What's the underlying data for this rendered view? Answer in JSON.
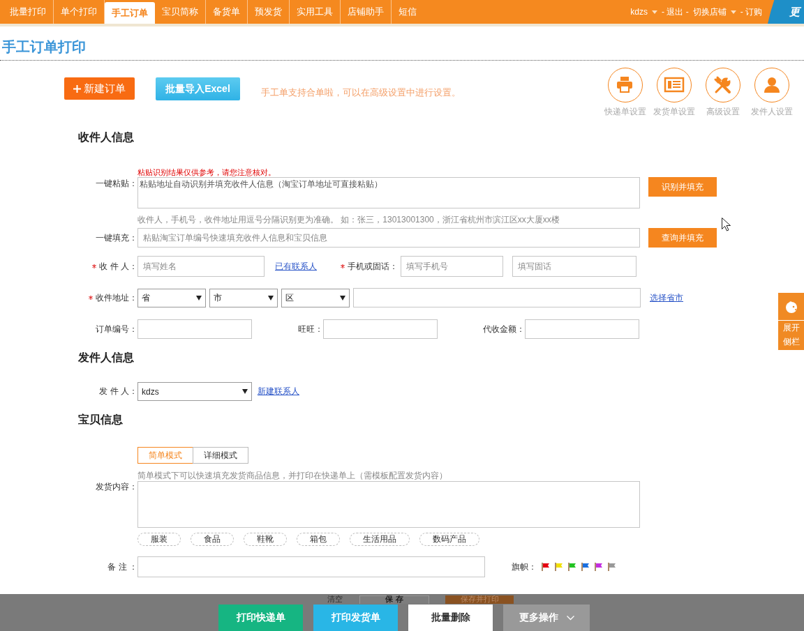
{
  "nav": {
    "items": [
      {
        "label": "批量打印",
        "selected": false
      },
      {
        "label": "单个打印",
        "selected": false
      },
      {
        "label": "手工订单",
        "selected": true
      },
      {
        "label": "宝贝简称",
        "selected": false
      },
      {
        "label": "备货单",
        "selected": false
      },
      {
        "label": "预发货",
        "selected": false
      },
      {
        "label": "实用工具",
        "selected": false
      },
      {
        "label": "店铺助手",
        "selected": false
      },
      {
        "label": "短信",
        "selected": false
      }
    ],
    "user": "kdzs",
    "logout": "- 退出 -",
    "switch_shop": "切换店铺",
    "subscribe": "- 订购",
    "logo": "更"
  },
  "page_title": "手工订单打印",
  "toolbar": {
    "new_order": "新建订单",
    "import_excel": "批量导入Excel",
    "note": "手工单支持合单啦，可以在高级设置中进行设置。",
    "settings": [
      {
        "kind": "printer",
        "label": "快递单设置"
      },
      {
        "kind": "list",
        "label": "发货单设置"
      },
      {
        "kind": "tools",
        "label": "高级设置"
      },
      {
        "kind": "person",
        "label": "发件人设置"
      }
    ]
  },
  "receiver": {
    "heading": "收件人信息",
    "paste_warning": "粘贴识别结果仅供参考，请您注意核对。",
    "paste": {
      "label": "一键粘贴：",
      "placeholder": "粘贴地址自动识别并填充收件人信息（淘宝订单地址可直接粘贴）",
      "button": "识别并填充"
    },
    "paste_hint": "收件人，手机号，收件地址用逗号分隔识别更为准确。 如：张三，13013001300，浙江省杭州市滨江区xx大厦xx楼",
    "fill": {
      "label": "一键填充：",
      "placeholder": "粘贴淘宝订单编号快速填充收件人信息和宝贝信息",
      "button": "查询并填充"
    },
    "name": {
      "label": "收 件 人：",
      "required": true,
      "placeholder": "填写姓名",
      "link": "已有联系人"
    },
    "phone": {
      "label": "手机或固话：",
      "required": true,
      "mobile_placeholder": "填写手机号",
      "tel_placeholder": "填写固话"
    },
    "address": {
      "label": "收件地址：",
      "required": true,
      "province": "省",
      "city": "市",
      "district": "区",
      "link": "选择省市"
    },
    "order_no": {
      "label": "订单编号："
    },
    "wangwang": {
      "label": "旺旺："
    },
    "cod": {
      "label": "代收金额："
    }
  },
  "sender": {
    "heading": "发件人信息",
    "label": "发 件 人：",
    "value": "kdzs",
    "link": "新建联系人"
  },
  "items": {
    "heading": "宝贝信息",
    "modes": [
      {
        "label": "简单模式",
        "selected": true
      },
      {
        "label": "详细模式",
        "selected": false
      }
    ],
    "hint": "简单模式下可以快速填充发货商品信息，并打印在快递单上（需模板配置发货内容）",
    "content_label": "发货内容：",
    "tags": [
      "服装",
      "食品",
      "鞋靴",
      "箱包",
      "生活用品",
      "数码产品"
    ],
    "remark_label": "备 注 ：",
    "flag_label": "旗帜：",
    "flags": [
      {
        "color": "#e60012"
      },
      {
        "color": "#f2e000"
      },
      {
        "color": "#22c322"
      },
      {
        "color": "#1a6fe0"
      },
      {
        "color": "#c42ee0"
      },
      {
        "color": "#999999"
      }
    ]
  },
  "actions": [
    {
      "kind": "plain",
      "label": "清空"
    },
    {
      "kind": "outline",
      "label": "保 存"
    },
    {
      "kind": "primary",
      "label": "保存并打印"
    }
  ],
  "bottom_bar": [
    {
      "kind": "success",
      "label": "打印快递单"
    },
    {
      "kind": "info",
      "label": "打印发货单"
    },
    {
      "kind": "default",
      "label": "批量删除"
    },
    {
      "kind": "dropdown",
      "label": "更多操作"
    }
  ],
  "side_tab": {
    "label": "展开侧栏"
  }
}
